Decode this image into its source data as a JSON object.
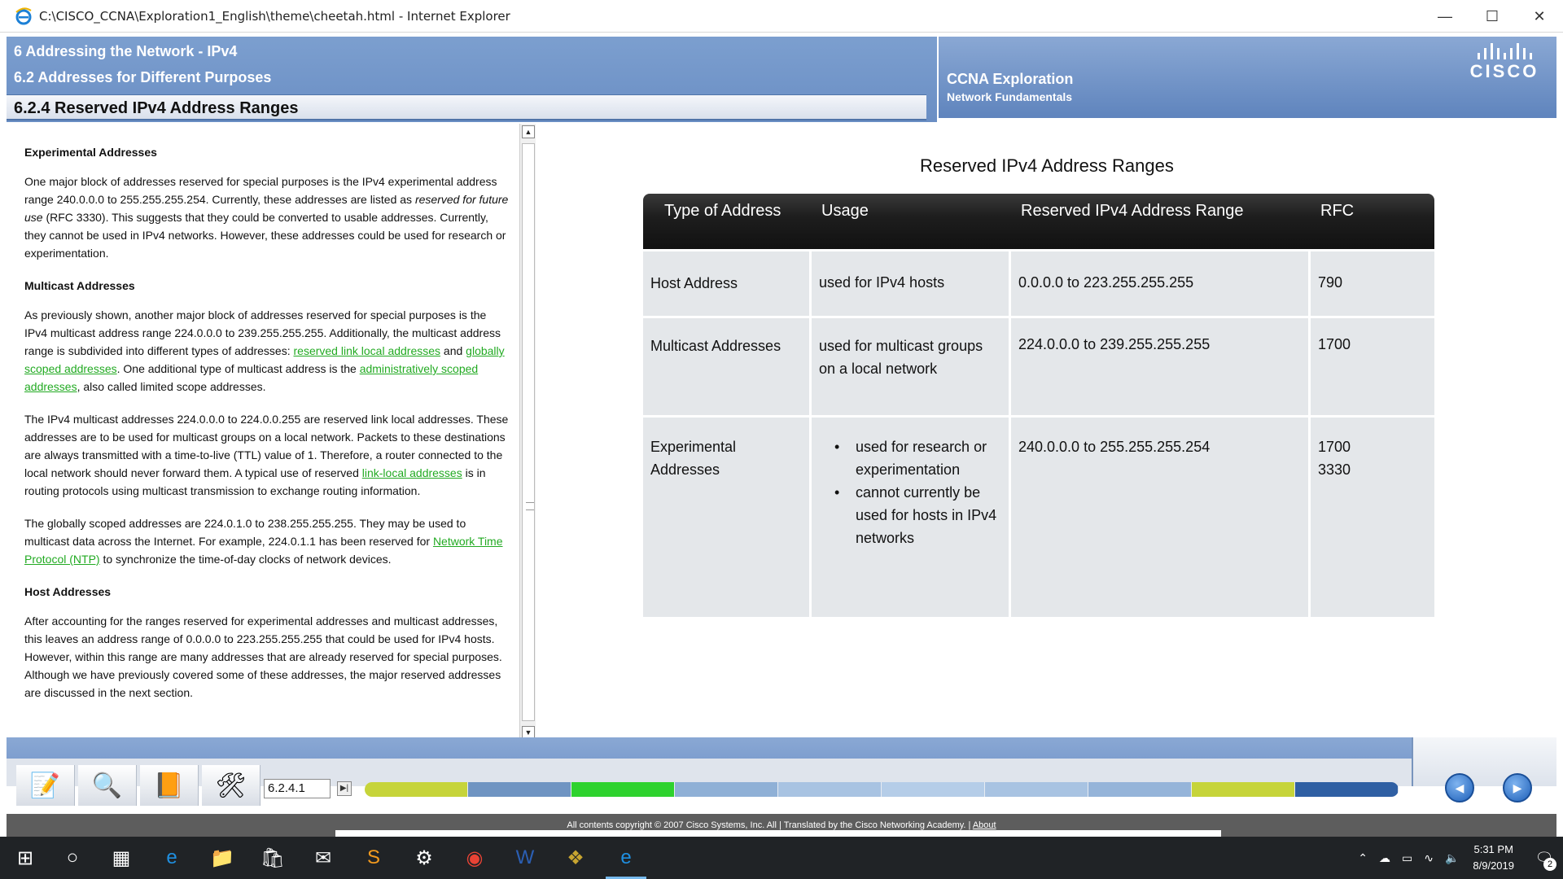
{
  "window": {
    "title": "C:\\CISCO_CCNA\\Exploration1_English\\theme\\cheetah.html - Internet Explorer",
    "minimize_icon": "minimize-icon",
    "maximize_icon": "maximize-icon",
    "close_icon": "close-icon"
  },
  "header": {
    "chapter": "6 Addressing the Network - IPv4",
    "section": "6.2 Addresses for Different Purposes",
    "topic": "6.2.4 Reserved IPv4 Address Ranges",
    "course": "CCNA Exploration",
    "course_sub": "Network Fundamentals",
    "logo_text": "CISCO"
  },
  "text_pane": {
    "h_experimental": "Experimental Addresses",
    "p_exp_1": "One major block of addresses reserved for special purposes is the IPv4 experimental address range 240.0.0.0 to 255.255.255.254. Currently, these addresses are listed as ",
    "p_exp_em": "reserved for future use",
    "p_exp_2": " (RFC 3330). This suggests that they could be converted to usable addresses. Currently, they cannot be used in IPv4 networks. However, these addresses could be used for research or experimentation.",
    "h_multicast": "Multicast Addresses",
    "p_mc_1": "As previously shown, another major block of addresses reserved for special purposes is the IPv4 multicast address range 224.0.0.0 to 239.255.255.255. Additionally, the multicast address range is subdivided into different types of addresses: ",
    "link_reserved": "reserved link local addresses",
    "p_mc_and": " and ",
    "link_global": "globally scoped addresses",
    "p_mc_2": ". One additional type of multicast address is the ",
    "link_admin": "administratively scoped addresses",
    "p_mc_3": ", also called limited scope addresses.",
    "p_ll_1": "The IPv4 multicast addresses 224.0.0.0 to 224.0.0.255 are reserved link local addresses. These addresses are to be used for multicast groups on a local network. Packets to these destinations are always transmitted with a time-to-live (TTL) value of 1. Therefore, a router connected to the local network should never forward them. A typical use of reserved ",
    "link_linklocal": "link-local addresses",
    "p_ll_2": " is in routing protocols using multicast transmission to exchange routing information.",
    "p_gs_1": "The globally scoped addresses are 224.0.1.0 to 238.255.255.255. They may be used to multicast data across the Internet. For example, 224.0.1.1 has been reserved for ",
    "link_ntp": "Network Time Protocol (NTP)",
    "p_gs_2": " to synchronize the time-of-day clocks of network devices.",
    "h_host": "Host Addresses",
    "p_host": "After accounting for the ranges reserved for experimental addresses and multicast addresses, this leaves an address range of 0.0.0.0 to 223.255.255.255 that could be used for IPv4 hosts. However, within this range are many addresses that are already reserved for special purposes. Although we have previously covered some of these addresses, the major reserved addresses are discussed in the next section."
  },
  "table": {
    "title": "Reserved IPv4 Address Ranges",
    "columns": [
      "Type of Address",
      "Usage",
      "Reserved IPv4 Address Range",
      "RFC"
    ],
    "rows": [
      {
        "type": "Host Address",
        "usage": "used for IPv4 hosts",
        "range": "0.0.0.0  to 223.255.255.255",
        "rfc": "790"
      },
      {
        "type": "Multicast Addresses",
        "usage": "used for multicast groups on a local network",
        "range": "224.0.0.0 to 239.255.255.255",
        "rfc": "1700"
      },
      {
        "type": "Experimental Addresses",
        "usage_items": [
          "used for research or experimentation",
          "cannot currently be used for hosts in IPv4 networks"
        ],
        "range": "240.0.0.0 to 255.255.255.254",
        "rfc": "1700",
        "rfc2": "3330"
      }
    ]
  },
  "toolbar": {
    "tools": [
      "glossary-icon",
      "search-icon",
      "book-icon",
      "tools-icon"
    ],
    "page_value": "6.2.4.1",
    "go_icon": "go-to-page-icon",
    "progress_colors": [
      "#c6d43a",
      "#6f94c2",
      "#2ed22e",
      "#8fb0d6",
      "#a8c3e2",
      "#b5cde8",
      "#a8c3e2",
      "#95b4d9",
      "#c6d43a",
      "#2f5fa3"
    ],
    "prev_icon": "back-arrow-icon",
    "next_icon": "forward-arrow-icon"
  },
  "footer": {
    "copyright": "All contents copyright © 2007 Cisco Systems, Inc. All | Translated by the Cisco Networking Academy. | ",
    "about": "About"
  },
  "taskbar": {
    "apps": [
      "windows-start-icon",
      "search-circle-icon",
      "task-view-icon",
      "edge-icon",
      "file-explorer-icon",
      "store-icon",
      "mail-icon",
      "sublime-icon",
      "settings-app-icon",
      "chrome-icon",
      "word-icon",
      "packet-tracer-icon",
      "internet-explorer-icon"
    ],
    "time": "5:31 PM",
    "date": "8/9/2019",
    "notifications": "2"
  }
}
